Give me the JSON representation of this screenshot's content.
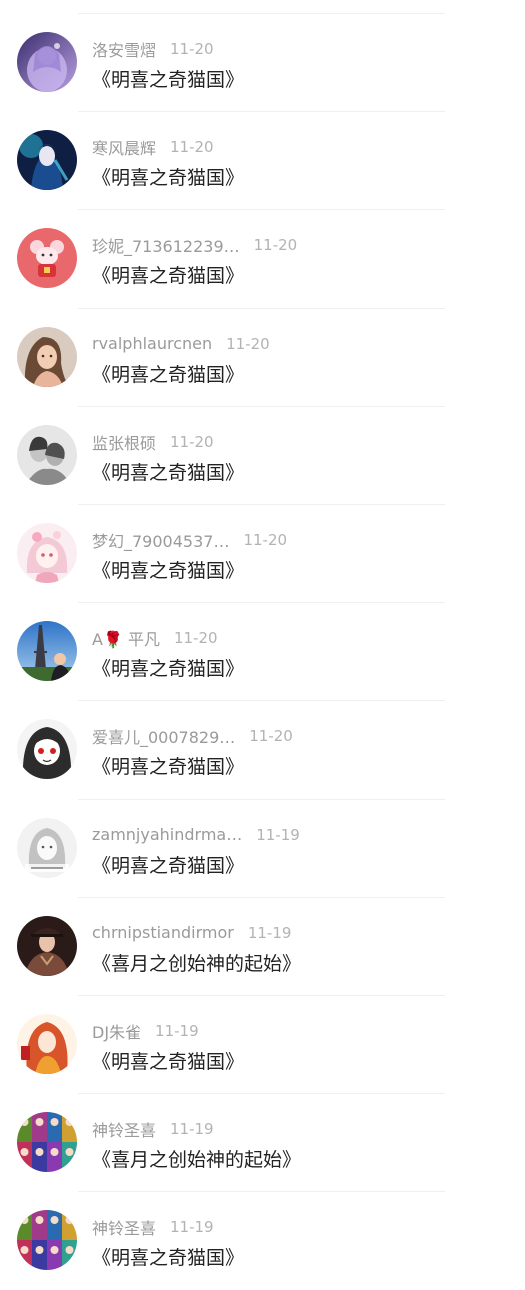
{
  "comments": [
    {
      "username": "洛安雪熠",
      "date": "11-20",
      "title": "《明喜之奇猫国》",
      "avatar_icon": "anime-girl-avatar",
      "avatar_color": "#8a72c8"
    },
    {
      "username": "寒风晨辉",
      "date": "11-20",
      "title": "《明喜之奇猫国》",
      "avatar_icon": "anime-boy-avatar",
      "avatar_color": "#1f3e78"
    },
    {
      "username": "珍妮_713612239…",
      "date": "11-20",
      "title": "《明喜之奇猫国》",
      "avatar_icon": "mouse-cartoon-avatar",
      "avatar_color": "#e46a6c"
    },
    {
      "username": "rvalphlaurcnen",
      "date": "11-20",
      "title": "《明喜之奇猫国》",
      "avatar_icon": "woman-photo-avatar",
      "avatar_color": "#b88a6a"
    },
    {
      "username": "监张根硕",
      "date": "11-20",
      "title": "《明喜之奇猫国》",
      "avatar_icon": "couple-bw-avatar",
      "avatar_color": "#9a9a9a"
    },
    {
      "username": "梦幻_79004537…",
      "date": "11-20",
      "title": "《明喜之奇猫国》",
      "avatar_icon": "pink-anime-girl-avatar",
      "avatar_color": "#f0c4d2"
    },
    {
      "username": "A🌹 平凡",
      "date": "11-20",
      "title": "《明喜之奇猫国》",
      "avatar_icon": "eiffel-tower-avatar",
      "avatar_color": "#4a84c8"
    },
    {
      "username": "爱喜儿_0007829…",
      "date": "11-20",
      "title": "《明喜之奇猫国》",
      "avatar_icon": "manga-girl-avatar",
      "avatar_color": "#5a5a5a"
    },
    {
      "username": "zamnjyahindrma…",
      "date": "11-19",
      "title": "《明喜之奇猫国》",
      "avatar_icon": "sketch-girl-avatar",
      "avatar_color": "#d8d8d8"
    },
    {
      "username": "chrnipstiandirmor",
      "date": "11-19",
      "title": "《喜月之创始神的起始》",
      "avatar_icon": "military-man-avatar",
      "avatar_color": "#6a4238"
    },
    {
      "username": "DJ朱雀",
      "date": "11-19",
      "title": "《明喜之奇猫国》",
      "avatar_icon": "red-haired-girl-avatar",
      "avatar_color": "#d8542a"
    },
    {
      "username": "神铃圣喜",
      "date": "11-19",
      "title": "《喜月之创始神的起始》",
      "avatar_icon": "character-collage-avatar",
      "avatar_color": "#7a4aa8"
    },
    {
      "username": "神铃圣喜",
      "date": "11-19",
      "title": "《明喜之奇猫国》",
      "avatar_icon": "character-collage-avatar",
      "avatar_color": "#7a4aa8"
    }
  ]
}
